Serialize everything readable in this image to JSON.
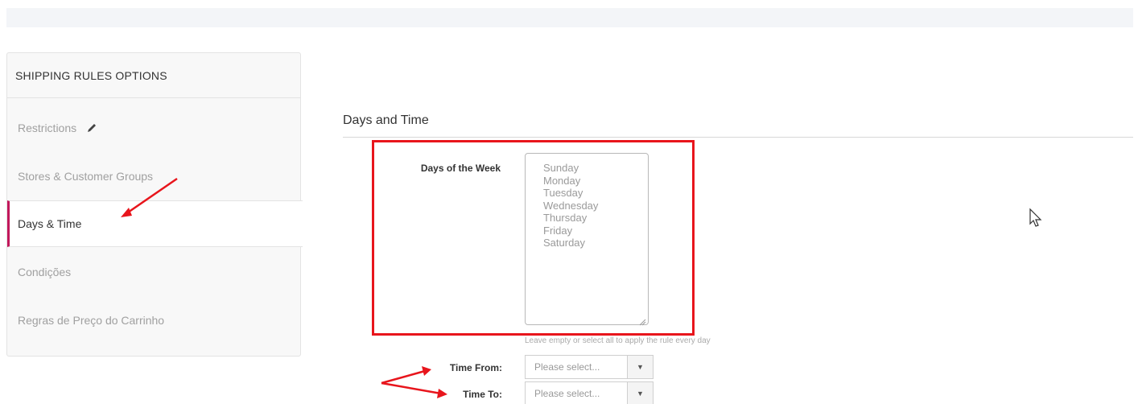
{
  "sidebar": {
    "header": "SHIPPING RULES OPTIONS",
    "items": [
      {
        "label": "Restrictions"
      },
      {
        "label": "Stores & Customer Groups"
      },
      {
        "label": "Days & Time"
      },
      {
        "label": "Condições"
      },
      {
        "label": "Regras de Preço do Carrinho"
      }
    ]
  },
  "main": {
    "section_title": "Days and Time",
    "days": {
      "label": "Days of the Week",
      "options": [
        "Sunday",
        "Monday",
        "Tuesday",
        "Wednesday",
        "Thursday",
        "Friday",
        "Saturday"
      ],
      "hint": "Leave empty or select all to apply the rule every day"
    },
    "time_from": {
      "label": "Time From:",
      "placeholder": "Please select..."
    },
    "time_to": {
      "label": "Time To:",
      "placeholder": "Please select..."
    }
  },
  "colors": {
    "annotation_red": "#e8151c",
    "active_accent": "#c2185b"
  },
  "icons": [
    "pencil-icon",
    "chevron-down-icon",
    "mouse-cursor-icon",
    "resize-grip-icon",
    "arrow-annotation"
  ]
}
